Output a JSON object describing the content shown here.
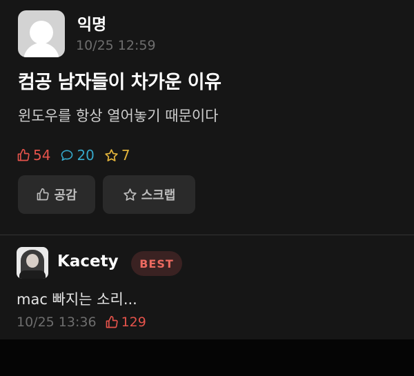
{
  "post": {
    "author": "익명",
    "time": "10/25 12:59",
    "title": "컴공 남자들이 차가운 이유",
    "body": "윈도우를 항상 열어놓기 때문이다",
    "stats": {
      "likes": "54",
      "comments": "20",
      "scraps": "7"
    },
    "buttons": {
      "like": "공감",
      "scrap": "스크랩"
    }
  },
  "comment": {
    "author": "Kacety",
    "badge": "BEST",
    "text": "mac 빠지는 소리...",
    "time": "10/25 13:36",
    "likes": "129"
  },
  "colors": {
    "like": "#e5534b",
    "comment": "#35a7c9",
    "scrap": "#e2b33b",
    "badge_text": "#ec6a60",
    "badge_bg": "#3a2222",
    "background": "#161616"
  },
  "icons": [
    "thumbs-up-icon",
    "speech-bubble-icon",
    "star-icon",
    "anonymous-avatar-icon"
  ]
}
